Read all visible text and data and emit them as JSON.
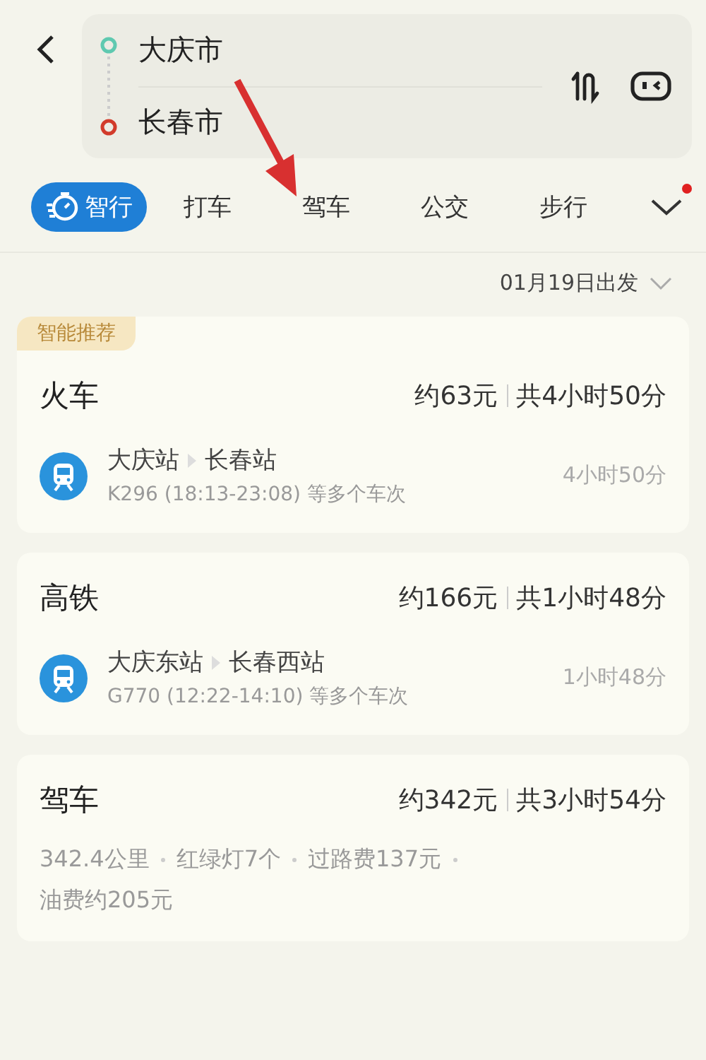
{
  "header": {
    "origin": "大庆市",
    "destination": "长春市"
  },
  "tabs": [
    {
      "label": "智行",
      "selected": true
    },
    {
      "label": "打车",
      "selected": false
    },
    {
      "label": "驾车",
      "selected": false
    },
    {
      "label": "公交",
      "selected": false
    },
    {
      "label": "步行",
      "selected": false
    }
  ],
  "more_tabs": {
    "notification": true
  },
  "departure": "01月19日出发",
  "options": [
    {
      "kind": "train",
      "badge": "智能推荐",
      "title": "火车",
      "price": "约63元",
      "duration": "共4小时50分",
      "from": "大庆站",
      "to": "长春站",
      "trains": "K296 (18:13-23:08) 等多个车次",
      "travel_time": "4小时50分"
    },
    {
      "kind": "train",
      "title": "高铁",
      "price": "约166元",
      "duration": "共1小时48分",
      "from": "大庆东站",
      "to": "长春西站",
      "trains": "G770 (12:22-14:10) 等多个车次",
      "travel_time": "1小时48分"
    },
    {
      "kind": "drive",
      "title": "驾车",
      "price": "约342元",
      "duration": "共3小时54分",
      "details": [
        "342.4公里",
        "红绿灯7个",
        "过路费137元",
        "油费约205元"
      ]
    }
  ]
}
